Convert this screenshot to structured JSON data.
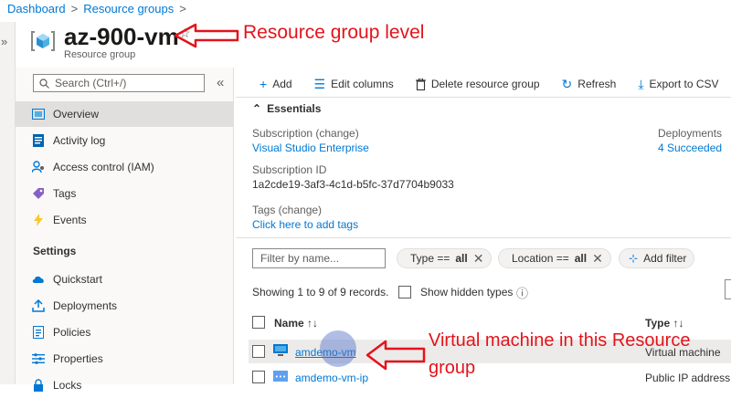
{
  "breadcrumb": {
    "items": [
      "Dashboard",
      "Resource groups"
    ]
  },
  "header": {
    "title": "az-900-vm",
    "subtitle": "Resource group"
  },
  "sidebar": {
    "search_placeholder": "Search (Ctrl+/)",
    "collapse_glyph": "«",
    "items": [
      {
        "label": "Overview",
        "icon": "overview-icon",
        "active": true
      },
      {
        "label": "Activity log",
        "icon": "activity-log-icon"
      },
      {
        "label": "Access control (IAM)",
        "icon": "iam-icon"
      },
      {
        "label": "Tags",
        "icon": "tag-icon"
      },
      {
        "label": "Events",
        "icon": "lightning-icon"
      }
    ],
    "settings_heading": "Settings",
    "settings_items": [
      {
        "label": "Quickstart",
        "icon": "cloud-icon"
      },
      {
        "label": "Deployments",
        "icon": "upload-icon"
      },
      {
        "label": "Policies",
        "icon": "policy-icon"
      },
      {
        "label": "Properties",
        "icon": "properties-icon"
      },
      {
        "label": "Locks",
        "icon": "lock-icon"
      }
    ]
  },
  "toolbar": {
    "add": "Add",
    "edit_columns": "Edit columns",
    "delete": "Delete resource group",
    "refresh": "Refresh",
    "export": "Export to CSV"
  },
  "essentials": {
    "heading": "Essentials",
    "subscription_label": "Subscription (change)",
    "subscription_value": "Visual Studio Enterprise",
    "subscription_id_label": "Subscription ID",
    "subscription_id_value": "1a2cde19-3af3-4c1d-b5fc-37d7704b9033",
    "tags_label": "Tags (change)",
    "tags_value": "Click here to add tags",
    "deployments_label": "Deployments",
    "deployments_value": "4 Succeeded"
  },
  "filters": {
    "placeholder": "Filter by name...",
    "type_key": "Type ==",
    "type_val": "all",
    "location_key": "Location ==",
    "location_val": "all",
    "add_filter": "Add filter"
  },
  "records": {
    "showing": "Showing 1 to 9 of 9 records.",
    "show_hidden": "Show hidden types"
  },
  "table": {
    "columns": [
      "Name ↑↓",
      "Type ↑↓"
    ],
    "rows": [
      {
        "name": "amdemo-vm",
        "type": "Virtual machine"
      },
      {
        "name": "amdemo-vm-ip",
        "type": "Public IP address"
      }
    ]
  },
  "annotations": {
    "top": "Resource group level",
    "bottom_line1": "Virtual machine in this Resource",
    "bottom_line2": "group"
  },
  "colors": {
    "accent": "#0078d4",
    "annotation": "#e3131b"
  }
}
